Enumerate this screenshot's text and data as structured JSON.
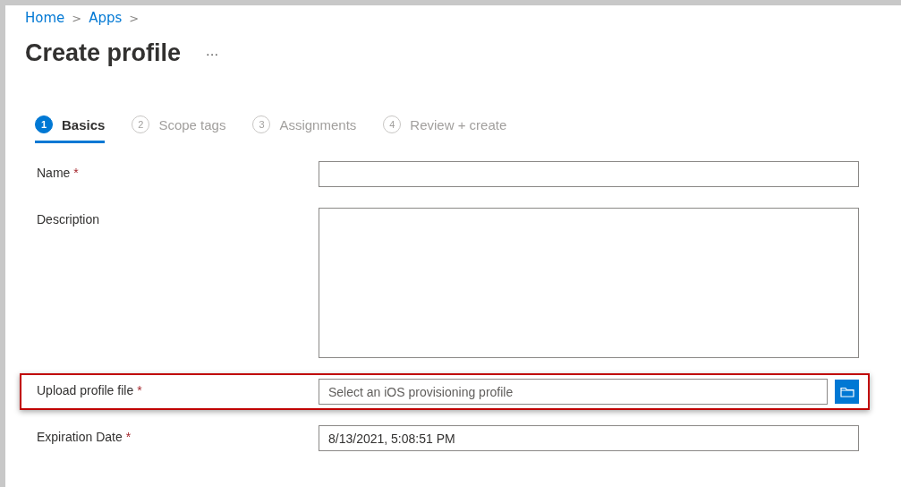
{
  "breadcrumb": [
    {
      "label": "Home",
      "separator": ">"
    },
    {
      "label": "Apps",
      "separator": ">"
    }
  ],
  "title": "Create profile",
  "more": "···",
  "steps": [
    {
      "number": "1",
      "label": "Basics",
      "selected": true
    },
    {
      "number": "2",
      "label": "Scope tags",
      "selected": false
    },
    {
      "number": "3",
      "label": "Assignments",
      "selected": false
    },
    {
      "number": "4",
      "label": "Review + create",
      "selected": false
    }
  ],
  "fields": [
    {
      "kind": "text",
      "label": "Name",
      "required_mark": "*",
      "highlighted": false
    },
    {
      "kind": "textarea",
      "label": "Description",
      "highlighted": false
    },
    {
      "kind": "file",
      "label": "Upload profile file",
      "required_mark": "*",
      "highlighted": true,
      "placeholder": "Select an iOS provisioning profile"
    },
    {
      "kind": "text",
      "label": "Expiration Date",
      "required_mark": "*",
      "highlighted": false,
      "value": "8/13/2021, 5:08:51 PM"
    }
  ]
}
